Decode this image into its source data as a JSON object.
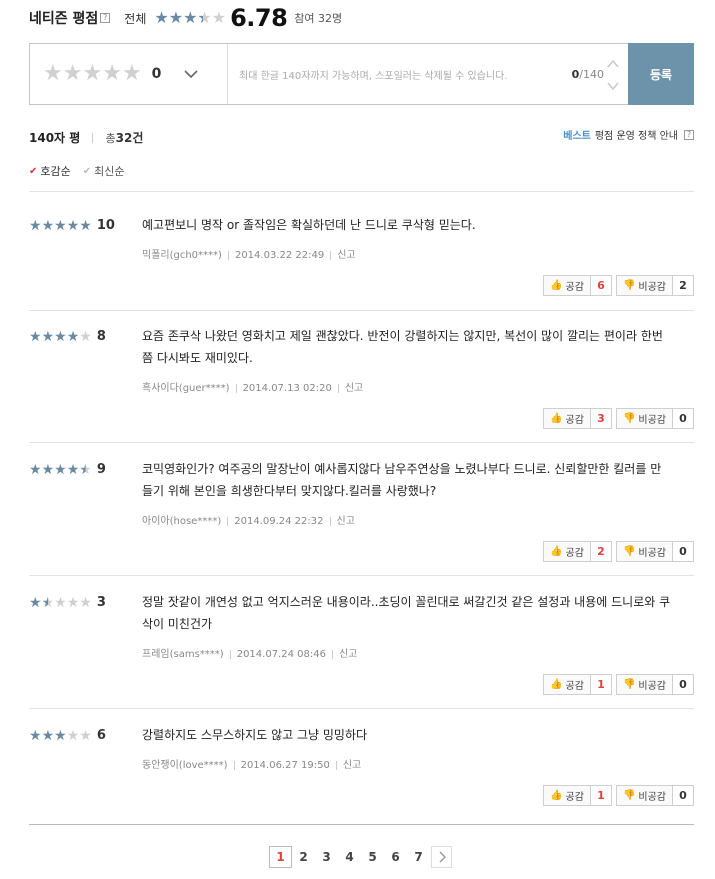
{
  "header": {
    "title": "네티즌 평점",
    "help": "?",
    "all_label": "전체",
    "score": "6.78",
    "participants": "참여 32명",
    "star_rating": 3.4
  },
  "input": {
    "rating_value": "0",
    "placeholder": "최대 한글 140자까지 가능하며, 스포일러는 삭제될 수 있습니다.",
    "counter_current": "0",
    "counter_max": "/140",
    "submit_label": "등록"
  },
  "list_header": {
    "label": "140자 평",
    "total_prefix": "총",
    "total_count": "32건",
    "policy_best": "베스트",
    "policy_text": "평점 운영 정책 안내",
    "help": "?"
  },
  "sort": {
    "options": [
      "호감순",
      "최신순"
    ],
    "selected": "호감순"
  },
  "reviews": [
    {
      "score": "10",
      "star_rating": 5,
      "text": "예고편보니 명작 or 졸작임은 확실하던데 난 드니로 쿠삭형 믿는다.",
      "author": "믹폴리(gch0****)",
      "date": "2014.03.22 22:49",
      "report": "신고",
      "like_label": "공감",
      "likes": "6",
      "dislike_label": "비공감",
      "dislikes": "2"
    },
    {
      "score": "8",
      "star_rating": 4,
      "text": "요즘 존쿠삭 나왔던 영화치고 제일 괜찮았다. 반전이 강렬하지는 않지만, 복선이 많이 깔리는 편이라 한번 쯤 다시봐도 재미있다.",
      "author": "흑사이다(guer****)",
      "date": "2014.07.13 02:20",
      "report": "신고",
      "like_label": "공감",
      "likes": "3",
      "dislike_label": "비공감",
      "dislikes": "0"
    },
    {
      "score": "9",
      "star_rating": 4.5,
      "text": "코믹영화인가? 여주공의 말장난이 예사롭지않다 남우주연상을 노렸나부다 드니로. 신뢰할만한 킬러를 만들기 위해 본인을 희생한다부터 맞지않다.킬러를 사랑했나?",
      "author": "아이아(hose****)",
      "date": "2014.09.24 22:32",
      "report": "신고",
      "like_label": "공감",
      "likes": "2",
      "dislike_label": "비공감",
      "dislikes": "0"
    },
    {
      "score": "3",
      "star_rating": 1.5,
      "text": "정말 잣같이 개연성 없고 억지스러운 내용이라..초딩이 꼴린대로 써갈긴것 같은 설정과 내용에 드니로와 쿠삭이 미친건가",
      "author": "프레임(sams****)",
      "date": "2014.07.24 08:46",
      "report": "신고",
      "like_label": "공감",
      "likes": "1",
      "dislike_label": "비공감",
      "dislikes": "0"
    },
    {
      "score": "6",
      "star_rating": 3,
      "text": "강렬하지도 스무스하지도 않고 그냥 밍밍하다",
      "author": "동안쟁이(love****)",
      "date": "2014.06.27 19:50",
      "report": "신고",
      "like_label": "공감",
      "likes": "1",
      "dislike_label": "비공감",
      "dislikes": "0"
    }
  ],
  "pagination": {
    "pages": [
      "1",
      "2",
      "3",
      "4",
      "5",
      "6",
      "7"
    ],
    "current": "1",
    "next_icon": "chevron-right-icon"
  },
  "colors": {
    "star_filled": "#6a8aa3",
    "star_empty": "#d0d0d0",
    "submit_bg": "#6d93ab",
    "like_count": "#e04040",
    "best_link": "#4a90c2"
  }
}
